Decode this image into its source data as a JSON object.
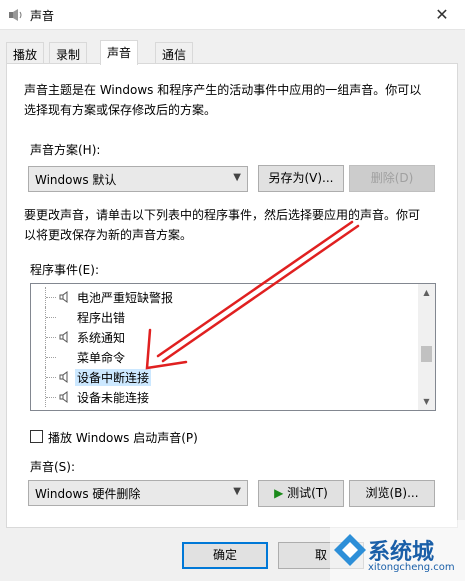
{
  "window": {
    "title": "声音",
    "close_symbol": "✕"
  },
  "tabs": [
    {
      "label": "播放"
    },
    {
      "label": "录制"
    },
    {
      "label": "声音"
    },
    {
      "label": "通信"
    }
  ],
  "intro": {
    "line1": "声音主题是在 Windows 和程序产生的活动事件中应用的一组声音。你可以",
    "line2": "选择现有方案或保存修改后的方案。"
  },
  "scheme": {
    "label": "声音方案(H):",
    "selected": "Windows 默认",
    "save_as": "另存为(V)...",
    "delete": "删除(D)"
  },
  "instruction": {
    "line1": "要更改声音，请单击以下列表中的程序事件，然后选择要应用的声音。你可",
    "line2": "以将更改保存为新的声音方案。"
  },
  "events": {
    "label": "程序事件(E):",
    "items": [
      {
        "label": "电池严重短缺警报",
        "has_sound": true
      },
      {
        "label": "程序出错",
        "has_sound": false
      },
      {
        "label": "系统通知",
        "has_sound": true
      },
      {
        "label": "菜单命令",
        "has_sound": false
      },
      {
        "label": "设备中断连接",
        "has_sound": true,
        "selected": true
      },
      {
        "label": "设备未能连接",
        "has_sound": true
      }
    ]
  },
  "startup": {
    "label": "播放 Windows 启动声音(P)",
    "checked": false
  },
  "sound": {
    "label": "声音(S):",
    "selected": "Windows 硬件删除",
    "test": "测试(T)",
    "browse": "浏览(B)..."
  },
  "footer": {
    "ok": "确定",
    "cancel": "取"
  },
  "watermark": {
    "brand": "系统城",
    "url": "xitongcheng.com"
  },
  "colors": {
    "accent": "#0078d7",
    "selection": "#cce8ff",
    "annotation_arrow": "#e02020"
  }
}
